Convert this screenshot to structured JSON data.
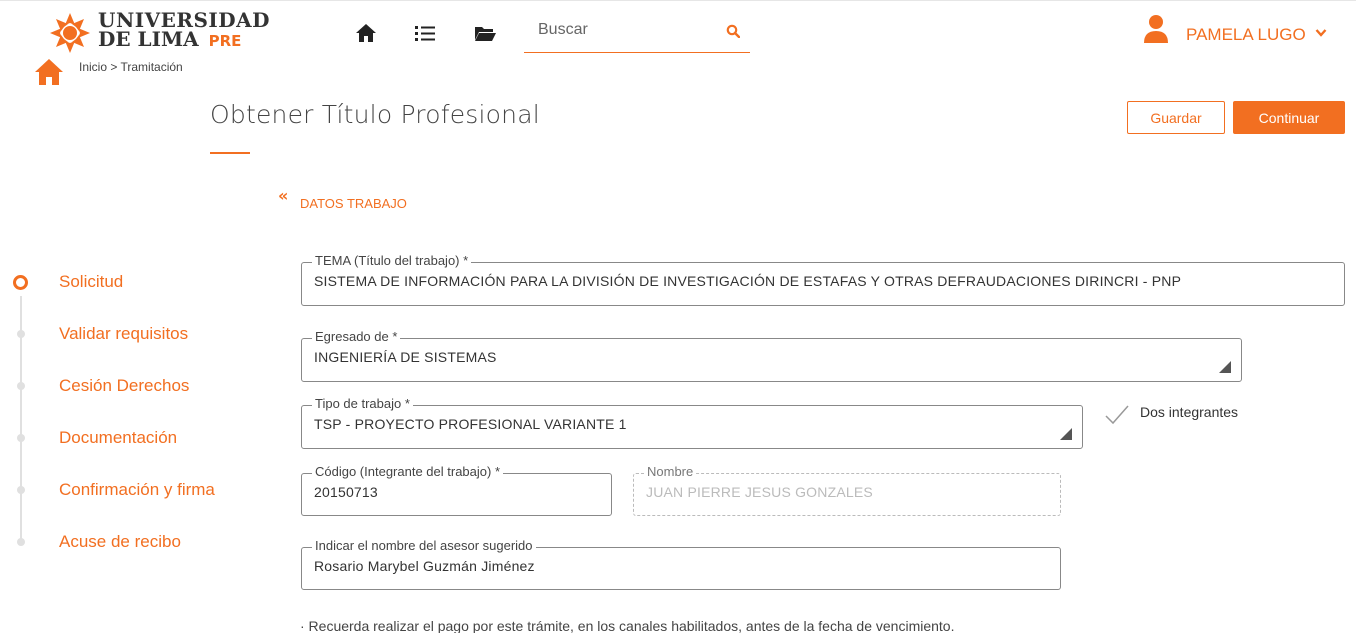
{
  "header": {
    "logo": {
      "line1": "UNIVERSIDAD",
      "line2": "DE LIMA",
      "tag": "PRE"
    },
    "nav_icons": [
      "home-icon",
      "list-icon",
      "folder-icon"
    ],
    "search": {
      "placeholder": "Buscar",
      "icon": "search-icon"
    },
    "user": {
      "name": "PAMELA LUGO",
      "icon": "user-icon",
      "caret_icon": "chevron-down-icon"
    }
  },
  "breadcrumb": {
    "text": "Inicio  >  Tramitación"
  },
  "page": {
    "title": "Obtener Título Profesional",
    "save_label": "Guardar",
    "continue_label": "Continuar"
  },
  "section": {
    "chevron": "«",
    "title": "DATOS TRABAJO"
  },
  "steps": [
    {
      "label": "Solicitud",
      "active": true
    },
    {
      "label": "Validar requisitos",
      "active": false
    },
    {
      "label": "Cesión Derechos",
      "active": false
    },
    {
      "label": "Documentación",
      "active": false
    },
    {
      "label": "Confirmación y firma",
      "active": false
    },
    {
      "label": "Acuse de recibo",
      "active": false
    }
  ],
  "form": {
    "tema": {
      "label": "TEMA (Título del trabajo) *",
      "value": "SISTEMA DE INFORMACIÓN PARA LA DIVISIÓN DE INVESTIGACIÓN DE ESTAFAS Y OTRAS DEFRAUDACIONES DIRINCRI - PNP"
    },
    "egresado": {
      "label": "Egresado de *",
      "value": "INGENIERÍA DE SISTEMAS"
    },
    "tipo": {
      "label": "Tipo de trabajo *",
      "value": "TSP - PROYECTO PROFESIONAL VARIANTE 1"
    },
    "dos_integrantes": {
      "label": "Dos integrantes",
      "checked": true
    },
    "codigo": {
      "label": "Código (Integrante del trabajo) *",
      "value": "20150713"
    },
    "nombre": {
      "label": "Nombre",
      "value": "JUAN PIERRE JESUS GONZALES"
    },
    "asesor": {
      "label": "Indicar el nombre del asesor sugerido",
      "value": "Rosario Marybel Guzmán Jiménez"
    }
  },
  "note": "· Recuerda realizar el pago por este trámite, en los canales habilitados, antes de la fecha de vencimiento.",
  "colors": {
    "accent": "#f26f21",
    "text": "#333333",
    "border": "#888888"
  }
}
